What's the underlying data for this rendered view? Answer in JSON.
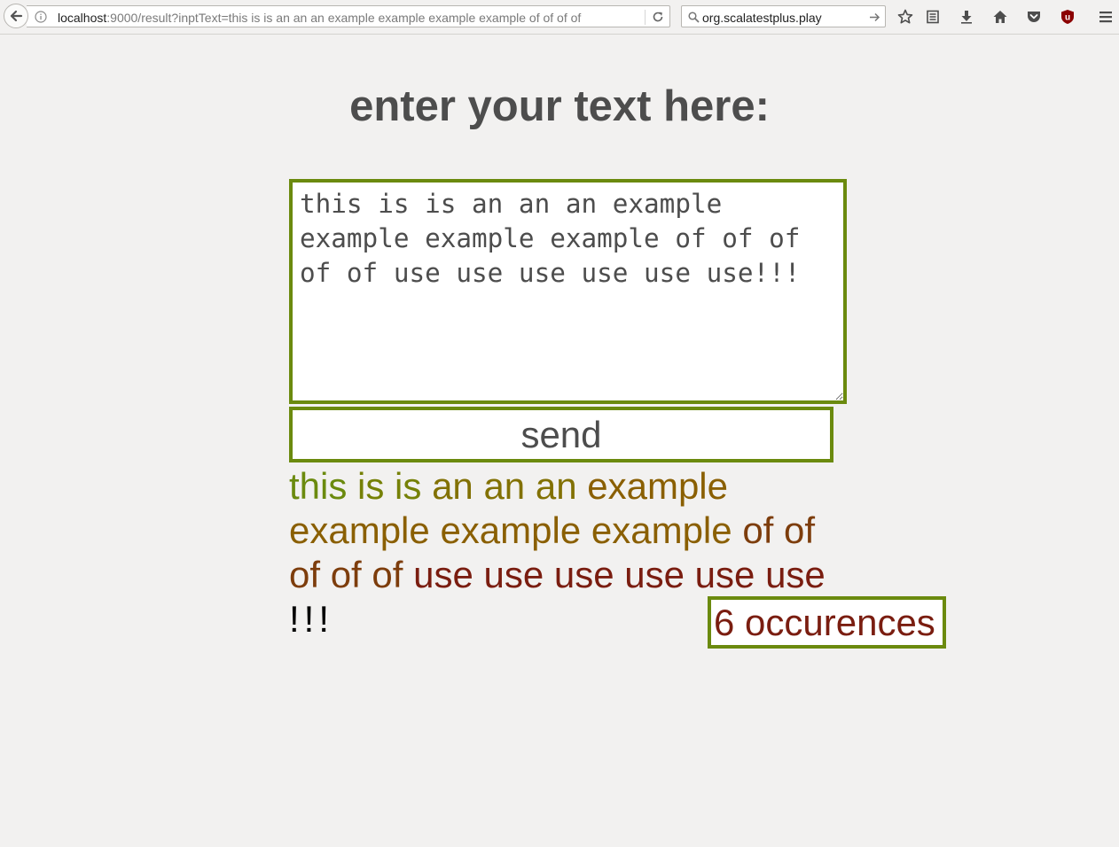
{
  "browser": {
    "url_host": "localhost",
    "url_rest": ":9000/result?inptText=this is is an an an example example example example of of of of",
    "search_value": "org.scalatestplus.play"
  },
  "page": {
    "title": "enter your text here:",
    "input_value": "this is is an an an example example example example of of of of of use use use use use use!!!",
    "send_label": "send",
    "occurrences_label": "6 occurences"
  },
  "result": {
    "words": [
      {
        "text": "this",
        "color": "#6b8a0e"
      },
      {
        "text": "is",
        "color": "#768107"
      },
      {
        "text": "is",
        "color": "#768107"
      },
      {
        "text": "an",
        "color": "#827104"
      },
      {
        "text": "an",
        "color": "#827104"
      },
      {
        "text": "an",
        "color": "#827104"
      },
      {
        "text": "example",
        "color": "#8a5f02"
      },
      {
        "text": "example",
        "color": "#8a5f02"
      },
      {
        "text": "example",
        "color": "#8a5f02"
      },
      {
        "text": "example",
        "color": "#8a5f02"
      },
      {
        "text": "of",
        "color": "#7d3d0c"
      },
      {
        "text": "of",
        "color": "#7d3d0c"
      },
      {
        "text": "of",
        "color": "#7d3d0c"
      },
      {
        "text": "of",
        "color": "#7d3d0c"
      },
      {
        "text": "of",
        "color": "#7d3d0c"
      },
      {
        "text": "use",
        "color": "#7a1d10"
      },
      {
        "text": "use",
        "color": "#7a1d10"
      },
      {
        "text": "use",
        "color": "#7a1d10"
      },
      {
        "text": "use",
        "color": "#7a1d10"
      },
      {
        "text": "use",
        "color": "#7a1d10"
      },
      {
        "text": "use",
        "color": "#7a1d10"
      },
      {
        "text": "!",
        "color": "#000000"
      },
      {
        "text": "!",
        "color": "#000000"
      },
      {
        "text": "!",
        "color": "#000000"
      }
    ]
  },
  "icons": {
    "back": "back-arrow-icon",
    "info": "info-icon",
    "reload": "reload-icon",
    "search": "search-icon",
    "go": "go-arrow-icon",
    "bookmark": "star-icon",
    "reading_list": "reading-list-icon",
    "downloads": "download-icon",
    "home": "home-icon",
    "pocket": "pocket-icon",
    "ublock": "ublock-icon",
    "menu": "hamburger-menu-icon"
  }
}
